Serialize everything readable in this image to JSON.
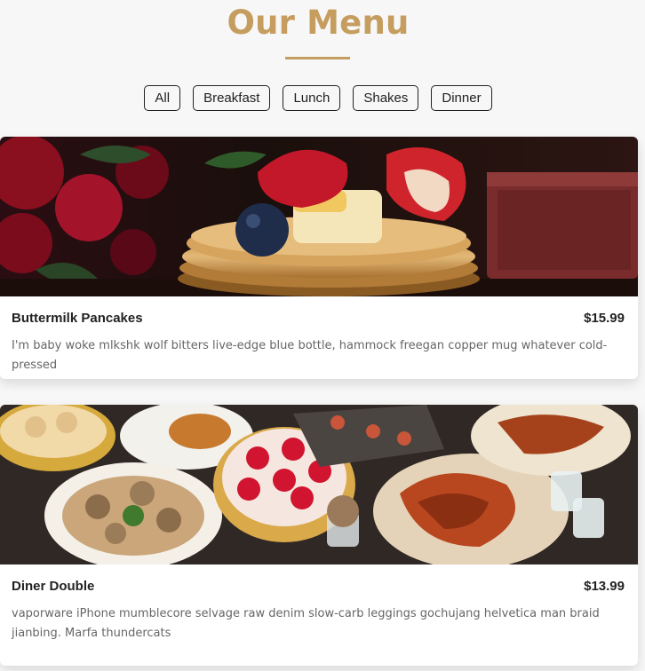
{
  "header": {
    "title": "Our Menu"
  },
  "filters": [
    {
      "label": "All"
    },
    {
      "label": "Breakfast"
    },
    {
      "label": "Lunch"
    },
    {
      "label": "Shakes"
    },
    {
      "label": "Dinner"
    }
  ],
  "items": [
    {
      "name": "Buttermilk Pancakes",
      "price": "$15.99",
      "desc": "I'm baby woke mlkshk wolf bitters live-edge blue bottle, hammock freegan copper mug whatever cold-pressed",
      "image": "pancakes-with-strawberries-photo"
    },
    {
      "name": "Diner Double",
      "price": "$13.99",
      "desc": "vaporware iPhone mumblecore selvage raw denim slow-carb leggings gochujang helvetica man braid jianbing. Marfa thundercats",
      "image": "dim-sum-seafood-spread-photo"
    }
  ],
  "colors": {
    "accent": "#c59d5f",
    "text": "#222222",
    "muted": "#666666",
    "background": "#f7f7f7"
  }
}
